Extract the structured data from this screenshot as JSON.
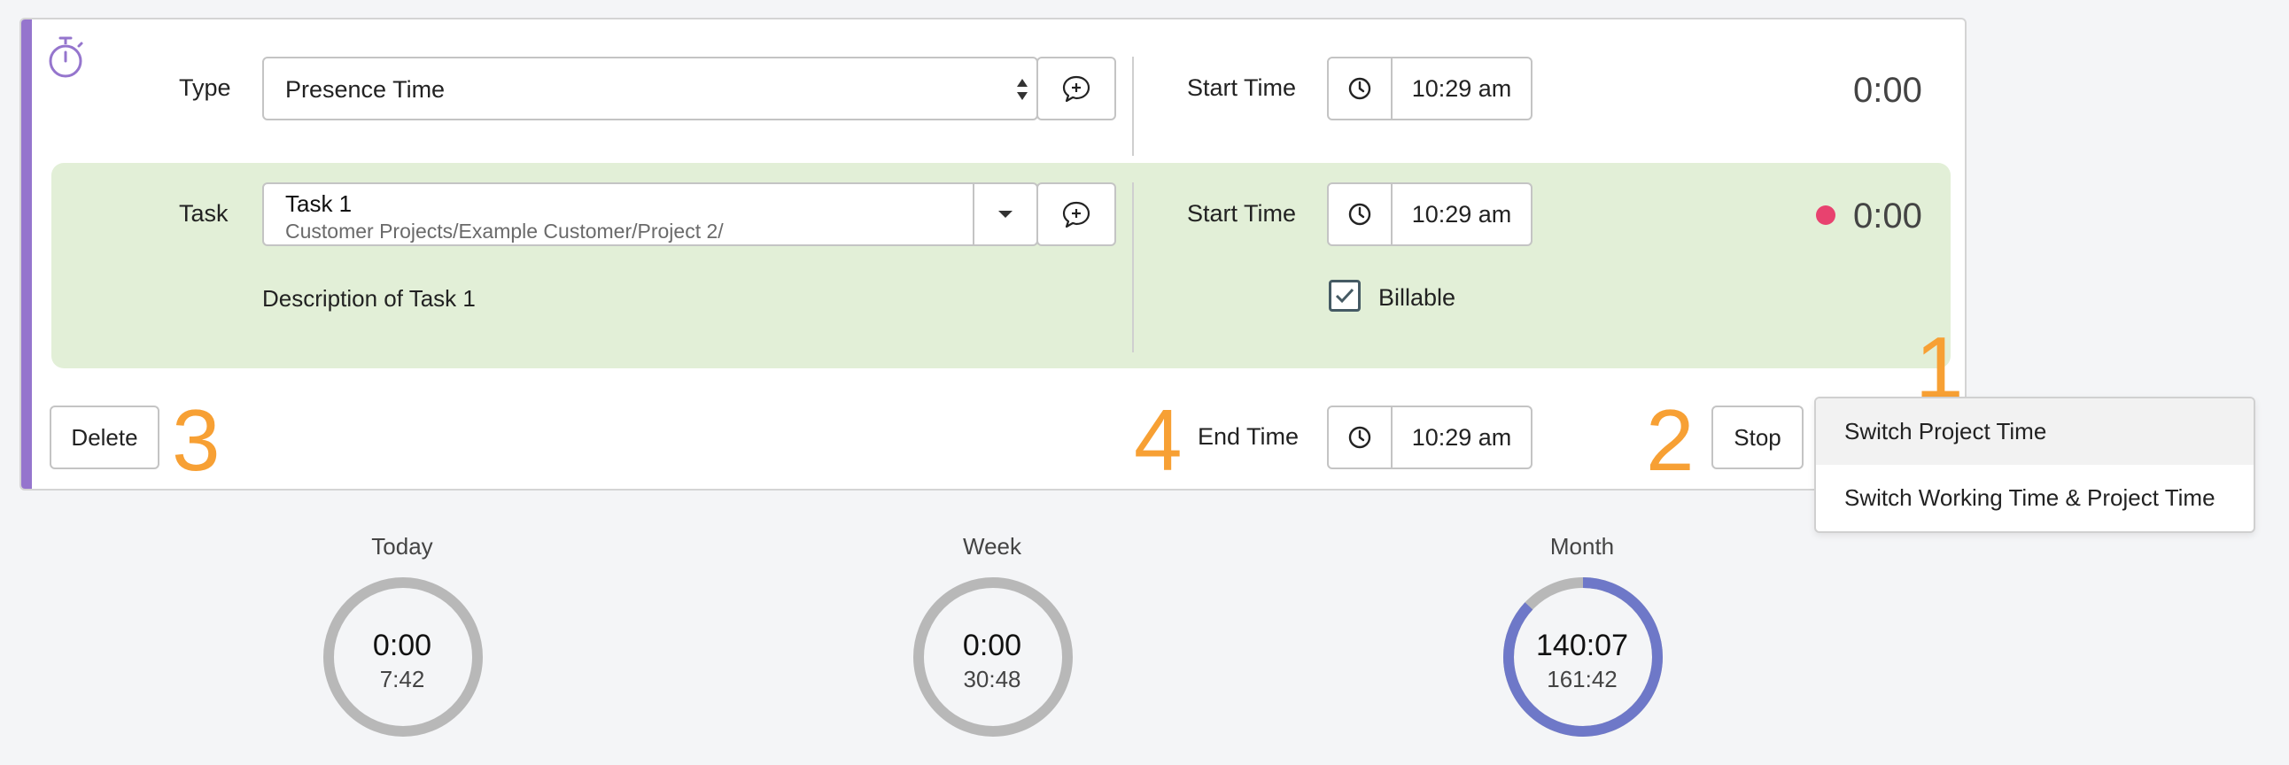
{
  "entry": {
    "type_label": "Type",
    "type_value": "Presence Time",
    "start_time_label": "Start Time",
    "start_time_value": "10:29 am",
    "duration": "0:00",
    "task": {
      "label": "Task",
      "name": "Task 1",
      "path": "Customer Projects/Example Customer/Project 2/",
      "description": "Description of Task 1",
      "start_time_label": "Start Time",
      "start_time_value": "10:29 am",
      "duration": "0:00",
      "billable_label": "Billable",
      "billable_checked": true,
      "running_dot_color": "#e8426f"
    },
    "end_time_label": "End Time",
    "end_time_value": "10:29 am",
    "delete_label": "Delete",
    "stop_label": "Stop"
  },
  "annotations": [
    "1",
    "2",
    "3",
    "4"
  ],
  "menu": {
    "items": [
      "Switch Project Time",
      "Switch Working Time & Project Time"
    ]
  },
  "stats": [
    {
      "label": "Today",
      "value": "0:00",
      "target": "7:42",
      "progress": 0
    },
    {
      "label": "Week",
      "value": "0:00",
      "target": "30:48",
      "progress": 0
    },
    {
      "label": "Month",
      "value": "140:07",
      "target": "161:42",
      "progress": 0.87
    }
  ],
  "colors": {
    "accent": "#9575cd",
    "task_bg": "#e2efd7",
    "annotation": "#f7a034",
    "ring_progress": "#6e78c8",
    "ring_track": "#b8b8b8"
  }
}
